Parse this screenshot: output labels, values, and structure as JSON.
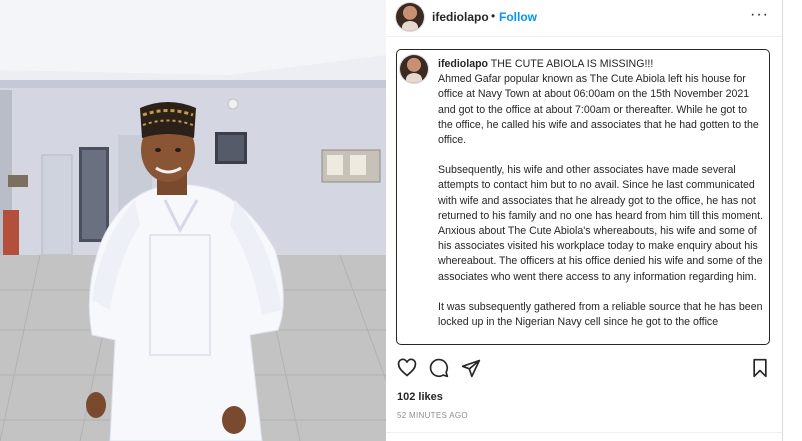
{
  "photo": {
    "description_icon": "post-photo"
  },
  "header": {
    "username": "ifediolapo",
    "separator": "•",
    "follow_label": "Follow",
    "more_label": "···"
  },
  "caption": {
    "author": "ifediolapo",
    "title": "THE CUTE ABIOLA IS MISSING!!!",
    "para1": "Ahmed Gafar popular known as The Cute Abiola left his house for office at Navy Town at about 06:00am on the 15th November 2021 and got to the office at about 7:00am or thereafter. While he got to the office, he called his wife and associates that he had gotten to the office.",
    "para2": "Subsequently, his wife and other associates have made several attempts to contact him but to no avail. Since he last communicated with wife and associates that he already got to the office, he has not returned to his family and no one has heard from him till this moment.",
    "para3": "Anxious about The Cute Abiola's whereabouts, his wife and some of his associates visited his workplace today to make enquiry about his whereabout. The officers at his office denied his wife and some of the associates who went there access to any information regarding him.",
    "para4": "It was subsequently gathered from a reliable source that he has been locked up in the Nigerian Navy cell since he got to the office"
  },
  "actions": {
    "like_icon": "heart-icon",
    "comment_icon": "comment-icon",
    "share_icon": "share-icon",
    "save_icon": "bookmark-icon"
  },
  "likes_text": "102 likes",
  "time_text": "52 MINUTES AGO",
  "colors": {
    "follow": "#0095f6",
    "text": "#262626",
    "muted": "#8e8e8e"
  }
}
